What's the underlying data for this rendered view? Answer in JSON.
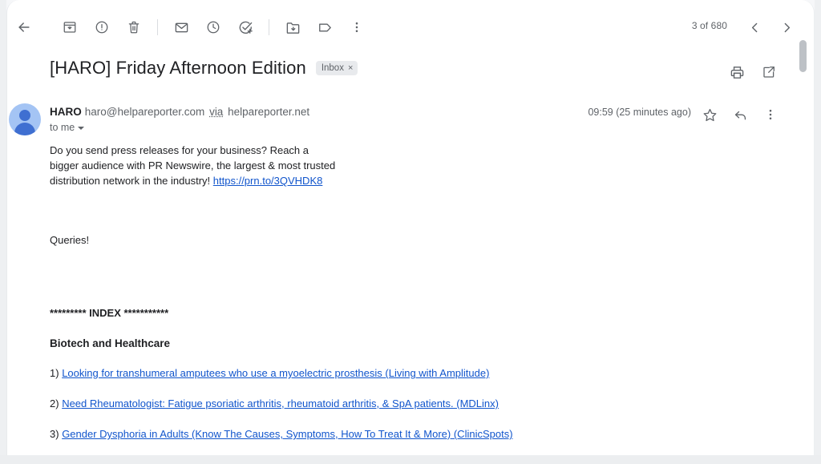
{
  "toolbar": {
    "back_label": "Back to inbox",
    "items": [
      {
        "name": "archive-icon",
        "label": "Archive"
      },
      {
        "name": "report-spam-icon",
        "label": "Report spam"
      },
      {
        "name": "delete-icon",
        "label": "Delete"
      },
      {
        "name": "mark-unread-icon",
        "label": "Mark as unread"
      },
      {
        "name": "snooze-icon",
        "label": "Snooze"
      },
      {
        "name": "add-to-tasks-icon",
        "label": "Add to tasks"
      },
      {
        "name": "move-to-icon",
        "label": "Move to"
      },
      {
        "name": "labels-icon",
        "label": "Labels"
      },
      {
        "name": "more-options-icon",
        "label": "More"
      }
    ]
  },
  "pagination": {
    "counter": "3 of 680",
    "prev_label": "Older",
    "next_label": "Newer"
  },
  "header": {
    "subject": "[HARO] Friday Afternoon Edition",
    "label_chip": "Inbox",
    "label_chip_remove": "×",
    "print_label": "Print all",
    "popout_label": "Open in new window"
  },
  "sender": {
    "name": "HARO",
    "email": "haro@helpareporter.com",
    "via_word": "via",
    "via_domain": "helpareporter.net",
    "recipient": "to me",
    "timestamp": "09:59 (25 minutes ago)",
    "star_label": "Star",
    "reply_label": "Reply",
    "more_label": "More"
  },
  "message": {
    "ad_text_before": "Do you send press releases for your business? Reach a bigger audience with PR Newswire, the largest & most trusted distribution network in the industry! ",
    "ad_link": "https://prn.to/3QVHDK8",
    "queries_line": "Queries!",
    "index_divider": "********* INDEX ***********",
    "category": "Biotech and Healthcare",
    "queries": [
      {
        "number": "1)",
        "text": "Looking for transhumeral amputees who use a myoelectric prosthesis (Living with Amplitude)"
      },
      {
        "number": "2)",
        "text": "Need Rheumatologist: Fatigue psoriatic arthritis, rheumatoid arthritis, & SpA patients. (MDLinx)"
      },
      {
        "number": "3)",
        "text": "Gender Dysphoria in Adults (Know The Causes, Symptoms, How To Treat It & More) (ClinicSpots)"
      }
    ]
  },
  "colors": {
    "link": "#1155cc",
    "text": "#202124",
    "muted": "#5f6368",
    "avatar_bg": "#a4c4f4",
    "avatar_fg": "#3f6fd1",
    "chip_bg": "#e8eaed"
  },
  "scrollbar": {
    "label": "Vertical scrollbar"
  }
}
